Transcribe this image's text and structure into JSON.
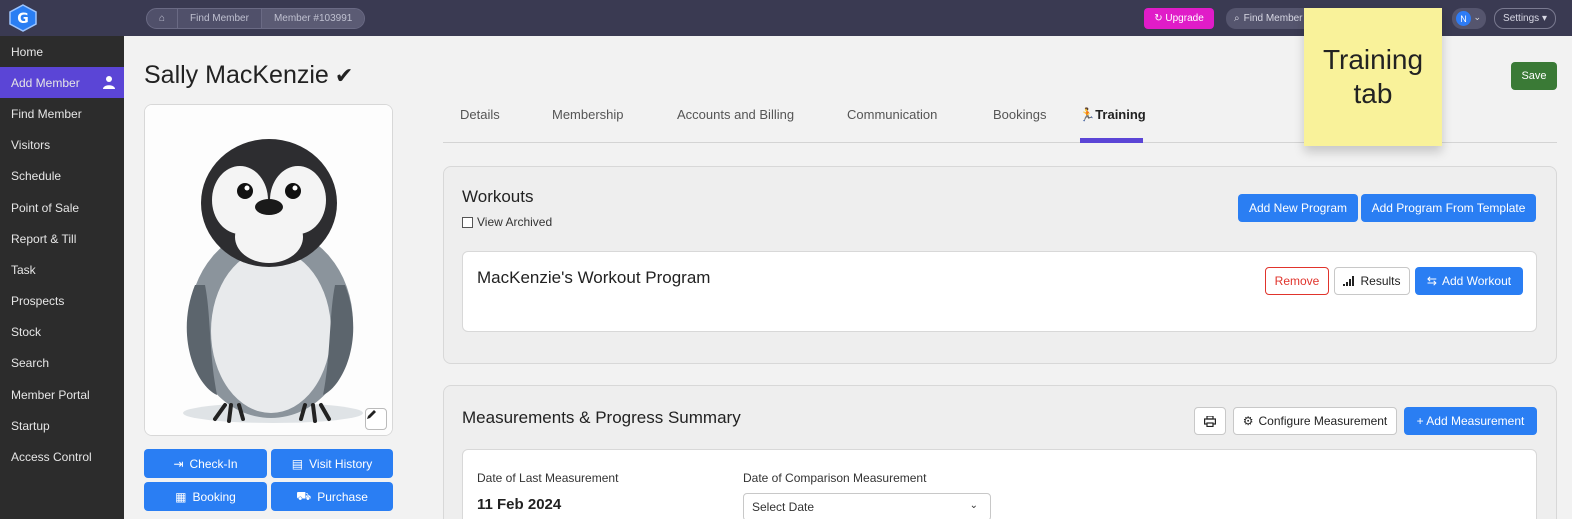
{
  "breadcrumb": {
    "home": "⌂",
    "find_member": "Find Member",
    "member": "Member #103991"
  },
  "topbar": {
    "upgrade": "↻ Upgrade",
    "search": "Find Member",
    "avatar_initial": "N",
    "settings": "Settings ▾"
  },
  "sidebar": {
    "items": [
      {
        "label": "Home"
      },
      {
        "label": "Add Member"
      },
      {
        "label": "Find Member"
      },
      {
        "label": "Visitors"
      },
      {
        "label": "Schedule"
      },
      {
        "label": "Point of Sale"
      },
      {
        "label": "Report & Till"
      },
      {
        "label": "Task"
      },
      {
        "label": "Prospects"
      },
      {
        "label": "Stock"
      },
      {
        "label": "Search"
      },
      {
        "label": "Member Portal"
      },
      {
        "label": "Startup"
      },
      {
        "label": "Access Control"
      }
    ]
  },
  "member": {
    "name": "Sally MacKenzie",
    "verified_mark": "✔"
  },
  "actions": {
    "checkin": "Check-In",
    "visit_history": "Visit History",
    "booking": "Booking",
    "purchase": "Purchase"
  },
  "tabs": [
    {
      "label": "Details"
    },
    {
      "label": "Membership"
    },
    {
      "label": "Accounts and Billing"
    },
    {
      "label": "Communication"
    },
    {
      "label": "Bookings"
    },
    {
      "label": "Training"
    }
  ],
  "save": "Save",
  "workouts": {
    "title": "Workouts",
    "view_archived": "View Archived",
    "add_new_program": "Add New Program",
    "add_from_template": "Add Program From Template",
    "program_name": "MacKenzie's Workout Program",
    "remove": "Remove",
    "results": "Results",
    "add_workout": "Add Workout"
  },
  "measurements": {
    "title": "Measurements & Progress Summary",
    "configure": "Configure Measurement",
    "add": "+ Add Measurement",
    "last_label": "Date of Last Measurement",
    "last_value": "11 Feb 2024",
    "comparison_label": "Date of Comparison Measurement",
    "comparison_value": "Select Date"
  },
  "sticky_note": "Training tab",
  "colors": {
    "accent": "#5b45d6",
    "primary": "#2a7ef3",
    "save": "#3a7a36",
    "upgrade": "#e01cc8",
    "sticky": "#f9f29a"
  }
}
